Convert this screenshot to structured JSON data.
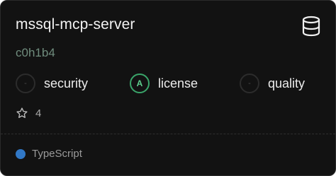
{
  "repo": {
    "name": "mssql-mcp-server",
    "owner": "c0h1b4",
    "icon": "database-icon"
  },
  "scores": [
    {
      "grade": "-",
      "label": "security"
    },
    {
      "grade": "A",
      "label": "license"
    },
    {
      "grade": "-",
      "label": "quality"
    }
  ],
  "stars": {
    "icon": "star-icon",
    "count": "4"
  },
  "language": {
    "name": "TypeScript",
    "color": "#3178c6"
  },
  "colors": {
    "card_bg": "#121212",
    "owner": "#6f8c7d",
    "grade_a": "#3aa56a"
  }
}
